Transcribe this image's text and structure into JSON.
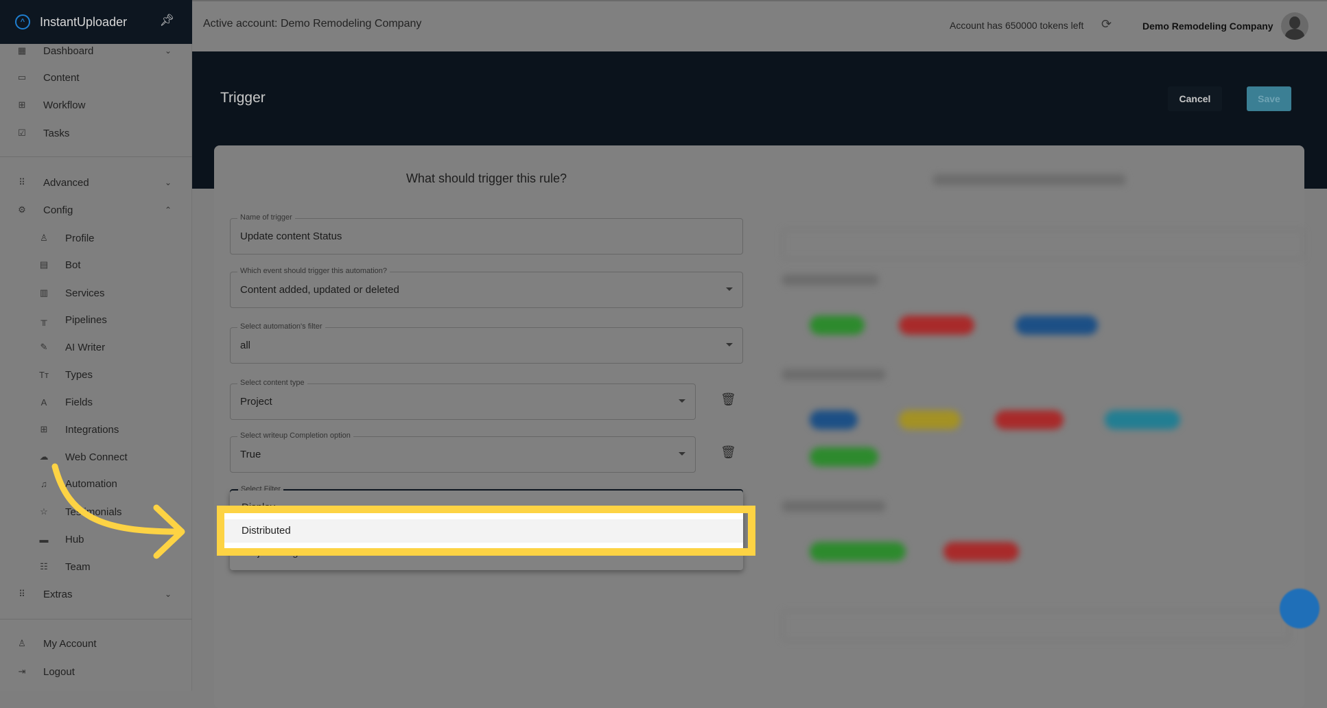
{
  "app": {
    "name": "InstantUploader",
    "logo_icon": "chevrons-up-circle-icon",
    "pin_icon": "pin-icon"
  },
  "sidebar": {
    "items": [
      {
        "label": "Dashboard",
        "icon": "dashboard-icon",
        "chevron": "down"
      },
      {
        "label": "Content",
        "icon": "folder-icon"
      },
      {
        "label": "Workflow",
        "icon": "grid-icon"
      },
      {
        "label": "Tasks",
        "icon": "checkbox-icon"
      },
      {
        "label": "Advanced",
        "icon": "apps-icon",
        "chevron": "down"
      },
      {
        "label": "Config",
        "icon": "gear-icon",
        "chevron": "up"
      },
      {
        "label": "Profile",
        "icon": "user-icon"
      },
      {
        "label": "Bot",
        "icon": "chat-icon"
      },
      {
        "label": "Services",
        "icon": "building-icon"
      },
      {
        "label": "Pipelines",
        "icon": "pipeline-icon"
      },
      {
        "label": "AI Writer",
        "icon": "pencil-icon"
      },
      {
        "label": "Types",
        "icon": "text-type-icon"
      },
      {
        "label": "Fields",
        "icon": "field-icon"
      },
      {
        "label": "Integrations",
        "icon": "plus-box-icon"
      },
      {
        "label": "Web Connect",
        "icon": "cloud-icon"
      },
      {
        "label": "Automation",
        "icon": "bell-icon"
      },
      {
        "label": "Testimonials",
        "icon": "star-icon"
      },
      {
        "label": "Hub",
        "icon": "hub-icon"
      },
      {
        "label": "Team",
        "icon": "team-icon"
      },
      {
        "label": "Extras",
        "icon": "apps-icon",
        "chevron": "down"
      },
      {
        "label": "My Account",
        "icon": "user-icon"
      },
      {
        "label": "Logout",
        "icon": "logout-icon"
      }
    ]
  },
  "topbar": {
    "active_account": "Active account: Demo Remodeling Company",
    "tokens": "Account has 650000 tokens left",
    "company": "Demo Remodeling Company"
  },
  "page": {
    "title": "Trigger",
    "cancel": "Cancel",
    "save": "Save"
  },
  "form": {
    "heading": "What should trigger this rule?",
    "fields": [
      {
        "label": "Name of trigger",
        "value": "Update content Status"
      },
      {
        "label": "Which event should trigger this automation?",
        "value": "Content added, updated or deleted"
      },
      {
        "label": "Select automation's filter",
        "value": "all"
      },
      {
        "label": "Select content type",
        "value": "Project"
      },
      {
        "label": "Select writeup Completion option",
        "value": "True"
      },
      {
        "label": "Select Filter",
        "value": ""
      }
    ],
    "menu_options": [
      "Display",
      "Distributed",
      "Project Progress"
    ],
    "highlighted_option": "Distributed"
  },
  "colors": {
    "highlight": "#fdd344",
    "dark": "#0b131c",
    "save": "#3b7f94"
  }
}
